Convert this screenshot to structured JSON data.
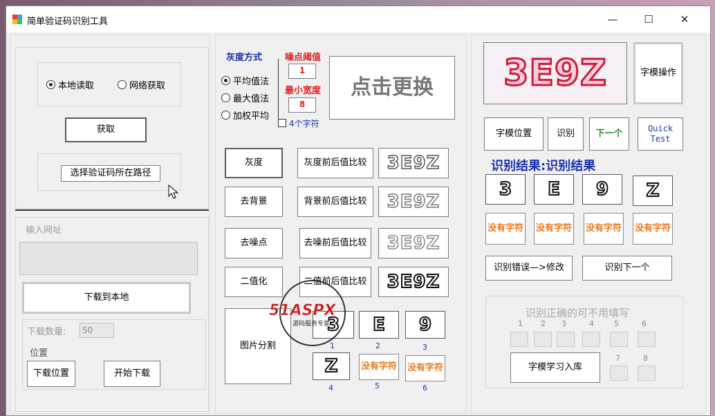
{
  "window": {
    "title": "简单验证码识别工具",
    "min": "—",
    "max": "☐",
    "close": "✕"
  },
  "left": {
    "radio_local": "本地读取",
    "radio_net": "网络获取",
    "fetch_button": "获取",
    "choose_path_button": "选择验证码所在路径",
    "url_label": "输入网址",
    "download_local_button": "下载到本地",
    "download_count_label": "下载数量:",
    "download_count_value": "50",
    "position_label": "位置",
    "download_position_button": "下载位置",
    "start_download_button": "开始下载"
  },
  "middle": {
    "gray_mode_title": "灰度方式",
    "gray_options": [
      "平均值法",
      "最大值法",
      "加权平均"
    ],
    "noise_threshold_label": "噪点阈值",
    "noise_threshold_value": "1",
    "min_width_label": "最小宽度",
    "min_width_value": "8",
    "four_chars_label": "4个字符",
    "click_change": "点击更换",
    "ops": [
      {
        "btn": "灰度",
        "compare": "灰度前后值比较"
      },
      {
        "btn": "去背景",
        "compare": "背景前后值比较"
      },
      {
        "btn": "去噪点",
        "compare": "去噪前后值比较"
      },
      {
        "btn": "二值化",
        "compare": "二值前后值比较"
      }
    ],
    "captcha_text": "3E9Z",
    "split_button": "图片分割",
    "segments": [
      "3",
      "E",
      "9",
      "Z"
    ],
    "no_char": "没有字符",
    "segment_indices": [
      "1",
      "2",
      "3",
      "4",
      "5",
      "6"
    ]
  },
  "right": {
    "captcha_text": "3E9Z",
    "template_ops_button": "字模操作",
    "template_pos_button": "字模位置",
    "recognize_button": "识别",
    "next_button": "下一个",
    "quick_test_button": "Quick Test",
    "result_title": "识别结果:识别结果",
    "result_chars": [
      "3",
      "E",
      "9",
      "Z"
    ],
    "no_char": "没有字符",
    "fix_error_button": "识别错误—>修改",
    "recognize_next_button": "识别下一个",
    "correct_hint": "识别正确的可不用填写",
    "slot_indices": [
      "1",
      "2",
      "3",
      "4",
      "5",
      "6",
      "7",
      "8"
    ],
    "learn_button": "字模学习入库"
  },
  "watermark": {
    "brand": "51ASPX",
    "sub": "源码服务专家"
  },
  "colors": {
    "blue_title": "#1a2fb0",
    "red_label": "#e02020",
    "orange": "#e8791c",
    "green": "#2a8a2a"
  }
}
